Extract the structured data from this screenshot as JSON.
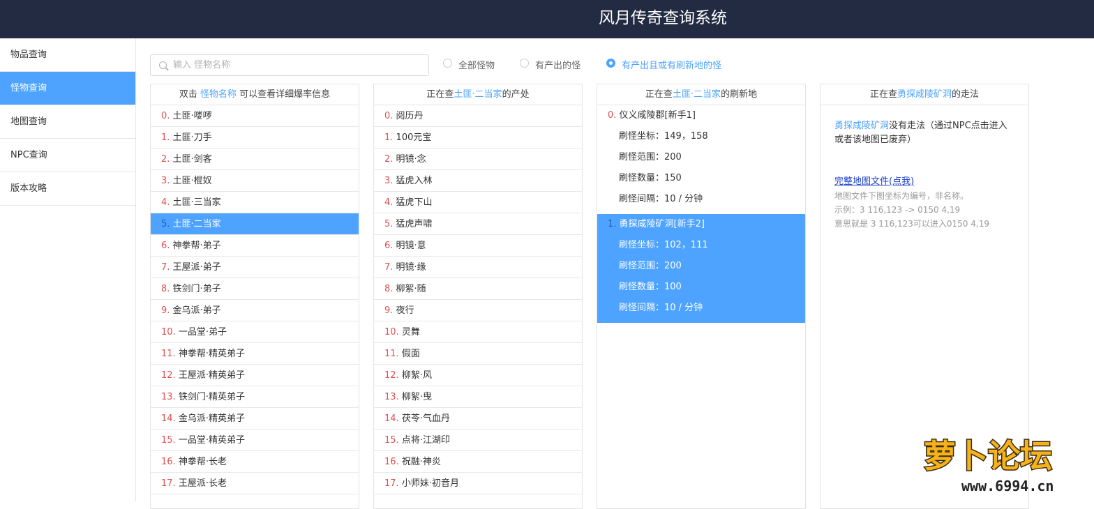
{
  "header": {
    "title": "风月传奇查询系统"
  },
  "sidebar": {
    "items": [
      {
        "label": "物品查询",
        "active": false
      },
      {
        "label": "怪物查询",
        "active": true
      },
      {
        "label": "地图查询",
        "active": false
      },
      {
        "label": "NPC查询",
        "active": false
      },
      {
        "label": "版本攻略",
        "active": false
      }
    ]
  },
  "search": {
    "placeholder": "输入 怪物名称",
    "value": ""
  },
  "filters": [
    {
      "label": "全部怪物",
      "selected": false
    },
    {
      "label": "有产出的怪",
      "selected": false
    },
    {
      "label": "有产出且或有刷新地的怪",
      "selected": true
    }
  ],
  "monsters": {
    "header_prefix": "双击",
    "header_link": "怪物名称",
    "header_suffix": "可以查看详细爆率信息",
    "selected_index": 5,
    "items": [
      {
        "idx": "0.",
        "name": "土匪·喽啰"
      },
      {
        "idx": "1.",
        "name": "土匪·刀手"
      },
      {
        "idx": "2.",
        "name": "土匪·剑客"
      },
      {
        "idx": "3.",
        "name": "土匪·棍奴"
      },
      {
        "idx": "4.",
        "name": "土匪·三当家"
      },
      {
        "idx": "5.",
        "name": "土匪·二当家"
      },
      {
        "idx": "6.",
        "name": "神拳帮·弟子"
      },
      {
        "idx": "7.",
        "name": "王屋派·弟子"
      },
      {
        "idx": "8.",
        "name": "铁剑门·弟子"
      },
      {
        "idx": "9.",
        "name": "金乌派·弟子"
      },
      {
        "idx": "10.",
        "name": "一品堂·弟子"
      },
      {
        "idx": "11.",
        "name": "神拳帮·精英弟子"
      },
      {
        "idx": "12.",
        "name": "王屋派·精英弟子"
      },
      {
        "idx": "13.",
        "name": "铁剑门·精英弟子"
      },
      {
        "idx": "14.",
        "name": "金乌派·精英弟子"
      },
      {
        "idx": "15.",
        "name": "一品堂·精英弟子"
      },
      {
        "idx": "16.",
        "name": "神拳帮·长老"
      },
      {
        "idx": "17.",
        "name": "王屋派·长老"
      }
    ]
  },
  "drops": {
    "header_prefix": "正在查",
    "header_link": "土匪·二当家",
    "header_suffix": "的产处",
    "items": [
      {
        "idx": "0.",
        "name": "阅历丹"
      },
      {
        "idx": "1.",
        "name": "100元宝"
      },
      {
        "idx": "2.",
        "name": "明镜·念"
      },
      {
        "idx": "3.",
        "name": "猛虎入林"
      },
      {
        "idx": "4.",
        "name": "猛虎下山"
      },
      {
        "idx": "5.",
        "name": "猛虎声啸"
      },
      {
        "idx": "6.",
        "name": "明镜·意"
      },
      {
        "idx": "7.",
        "name": "明镜·缘"
      },
      {
        "idx": "8.",
        "name": "柳絮·随"
      },
      {
        "idx": "9.",
        "name": "夜行"
      },
      {
        "idx": "10.",
        "name": "灵舞"
      },
      {
        "idx": "11.",
        "name": "假面"
      },
      {
        "idx": "12.",
        "name": "柳絮·风"
      },
      {
        "idx": "13.",
        "name": "柳絮·曳"
      },
      {
        "idx": "14.",
        "name": "茯苓·气血丹"
      },
      {
        "idx": "15.",
        "name": "点将·江湖印"
      },
      {
        "idx": "16.",
        "name": "祝融·神炎"
      },
      {
        "idx": "17.",
        "name": "小师妹·初音月"
      }
    ]
  },
  "spawns": {
    "header_prefix": "正在查",
    "header_link": "土匪·二当家",
    "header_suffix": "的刷新地",
    "selected_index": 1,
    "items": [
      {
        "idx": "0.",
        "map": "仪义咸陵郡[新手1]",
        "coord": "刷怪坐标：149，158",
        "range": "刷怪范围：200",
        "count": "刷怪数量：150",
        "interval": "刷怪间隔：10 / 分钟"
      },
      {
        "idx": "1.",
        "map": "勇探咸陵矿洞[新手2]",
        "coord": "刷怪坐标：102，111",
        "range": "刷怪范围：200",
        "count": "刷怪数量：100",
        "interval": "刷怪间隔：10 / 分钟"
      }
    ]
  },
  "route": {
    "header_prefix": "正在查",
    "header_link": "勇探咸陵矿洞",
    "header_suffix": "的走法",
    "map_link": "勇探咸陵矿洞",
    "no_route_text": "没有走法（通过NPC点击进入或者该地图已废弃）",
    "full_map_link": "完整地图文件(点我)",
    "note_1": "地图文件下图坐标为编号，非名称。",
    "note_2": "示例：3 116,123 -> 0150 4,19",
    "note_3": "意思就是 3 116,123可以进入0150 4,19"
  },
  "watermark": {
    "text": "萝卜论坛",
    "url": "www.6994.cn"
  }
}
